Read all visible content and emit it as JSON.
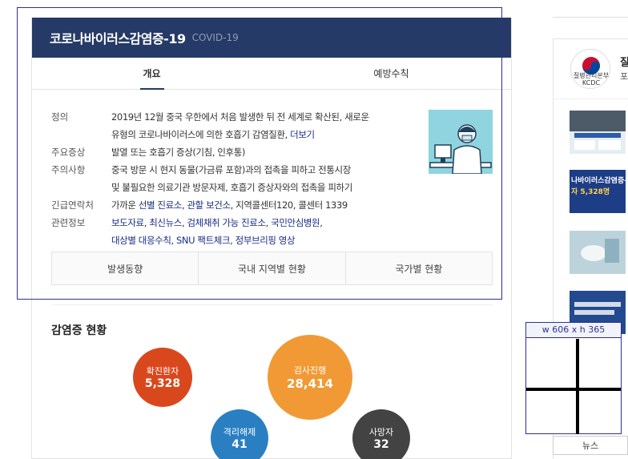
{
  "header": {
    "title": "코로나바이러스감염증-19",
    "subtitle": "COVID-19"
  },
  "tabs": [
    {
      "label": "개요"
    },
    {
      "label": "예방수칙"
    }
  ],
  "info": {
    "def_label": "정의",
    "def_line1": "2019년 12월 중국 우한에서 처음 발생한 뒤 전 세계로 확산된, 새로운",
    "def_line2": "유형의 코로나바이러스에 의한 호흡기 감염질환,",
    "def_more": "더보기",
    "sym_label": "주요증상",
    "sym_text": "발열 또는 호흡기 증상(기침, 인후통)",
    "caution_label": "주의사항",
    "caution_line1": "중국 방문 시 현지 동물(가금류 포함)과의 접촉을 피하고 전통시장",
    "caution_line2": "및 불필요한 의료기관 방문자제, 호흡기 증상자와의 접촉을 피하기",
    "contact_label": "긴급연락처",
    "contact_prefix": "가까운",
    "contact_link1": "선별 진료소",
    "contact_link2": "관할 보건소",
    "contact_suffix": "지역콜센터120, 콜센터 1339",
    "related_label": "관련정보",
    "related_link1": "보도자료",
    "related_link2": "최신뉴스",
    "related_link3": "검체채취 가능 진료소",
    "related_link4": "국민안심병원",
    "related_link5": "대상별 대응수칙",
    "related_link6": "SNU 팩트체크",
    "related_link7": "정부브리핑 영상"
  },
  "buttons": [
    {
      "label": "발생동향"
    },
    {
      "label": "국내 지역별 현황"
    },
    {
      "label": "국가별 현황"
    }
  ],
  "stats": {
    "title": "감염증 현황",
    "items": [
      {
        "label": "확진환자",
        "value": "5,328",
        "color": "#d9481d"
      },
      {
        "label": "검사진행",
        "value": "28,414",
        "color": "#f19a35"
      },
      {
        "label": "격리해제",
        "value": "41",
        "color": "#2a7fc3"
      },
      {
        "label": "사망자",
        "value": "32",
        "color": "#434343"
      }
    ]
  },
  "sidebar": {
    "logo_text_line1": "질병관리본부",
    "logo_text_line2": "KCDC",
    "title": "질",
    "subtitle": "포",
    "news_thumb2_line1": "나바이러스감염증-1",
    "news_thumb2_line2": "자 5,328명",
    "news_button": "뉴스"
  },
  "overlay": {
    "size_label": "w 606 x h 365"
  }
}
